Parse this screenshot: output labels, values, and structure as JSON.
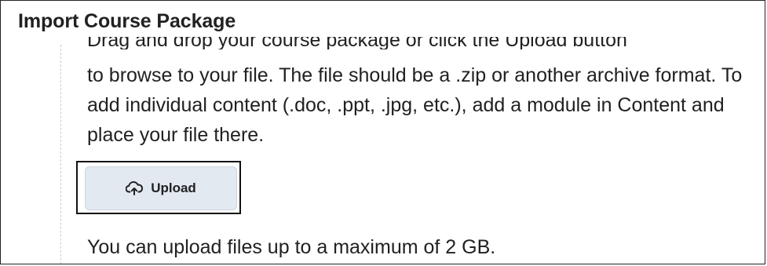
{
  "dialog": {
    "title": "Import Course Package",
    "partial_top_line": "Drag and drop your course package or click the Upload button",
    "description": "to browse to your file. The file should be a .zip or another archive format. To add individual content (.doc, .ppt, .jpg, etc.), add a module in Content and place your file there.",
    "upload_button": {
      "label": "Upload",
      "icon": "cloud-upload-icon"
    },
    "upload_limit_text": "You can upload files up to a maximum of 2 GB."
  },
  "colors": {
    "button_background": "#e3e9f1",
    "text": "#202122",
    "highlight_border": "#111111"
  }
}
